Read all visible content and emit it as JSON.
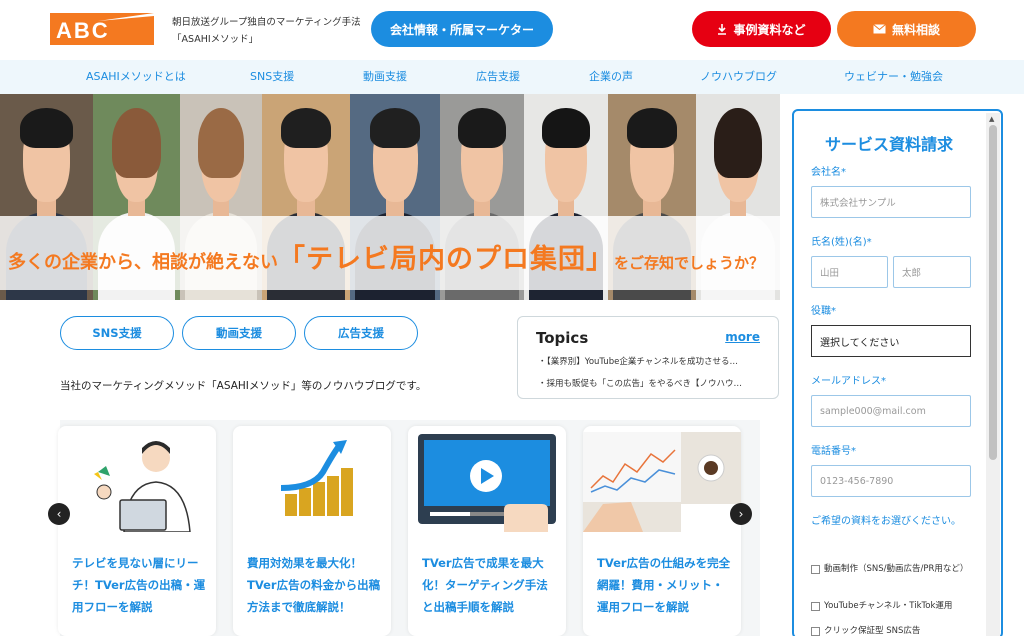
{
  "header": {
    "logo_text": "ABC",
    "tagline_line1": "朝日放送グループ独自のマーケティング手法",
    "tagline_line2": "「ASAHIメソッド」",
    "company_button": "会社情報・所属マーケター",
    "docs_button": "事例資料など",
    "consult_button": "無料相談"
  },
  "nav": {
    "items": [
      "ASAHIメソッドとは",
      "SNS支援",
      "動画支援",
      "広告支援",
      "企業の声",
      "ノウハウブログ",
      "ウェビナー・勉強会"
    ]
  },
  "hero": {
    "banner_part1": "多くの企業から、相談が絶えない",
    "banner_part2": "「テレビ局内のプロ集団」",
    "banner_part3": "をご存知でしょうか？"
  },
  "categories": [
    "SNS支援",
    "動画支援",
    "広告支援"
  ],
  "topics": {
    "title": "Topics",
    "more": "more",
    "items": [
      "・【業界別】YouTube企業チャンネルを成功させる…",
      "・採用も販促も「この広告」をやるべき【ノウハウ…"
    ]
  },
  "intro_text": "当社のマーケティングメソッド「ASAHIメソッド」等のノウハウブログです。",
  "cards": [
    {
      "title": "テレビを見ない層にリーチ！TVer広告の出稿・運用フローを解説"
    },
    {
      "title": "費用対効果を最大化！TVer広告の料金から出稿方法まで徹底解説！"
    },
    {
      "title": "TVer広告で成果を最大化！ターゲティング手法と出稿手順を解説"
    },
    {
      "title": "TVer広告の仕組みを完全網羅！費用・メリット・運用フローを解説"
    }
  ],
  "carousel": {
    "prev": "‹",
    "next": "›"
  },
  "form": {
    "title": "サービス資料請求",
    "company_label": "会社名*",
    "company_placeholder": "株式会社サンプル",
    "name_label": "氏名(姓)(名)*",
    "last_name_placeholder": "山田",
    "first_name_placeholder": "太郎",
    "role_label": "役職*",
    "role_value": "選択してください",
    "email_label": "メールアドレス*",
    "email_placeholder": "sample000@mail.com",
    "phone_label": "電話番号*",
    "phone_placeholder": "0123-456-7890",
    "materials_label": "ご希望の資料をお選びください。",
    "checkboxes": [
      "動画制作（SNS/動画広告/PR用など）",
      "YouTubeチャンネル・TikTok運用",
      "クリック保証型 SNS広告"
    ]
  },
  "colors": {
    "brand_orange": "#f47920",
    "brand_blue": "#1c8de0",
    "red": "#e60012",
    "nav_bg": "#eef7fc"
  }
}
